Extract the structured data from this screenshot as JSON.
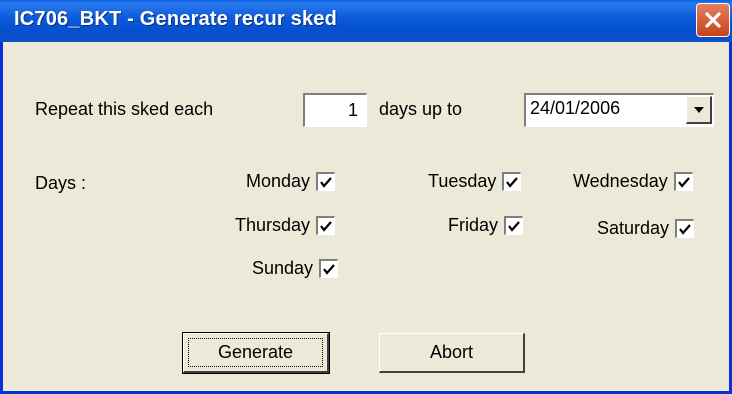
{
  "window": {
    "title": "IC706_BKT - Generate recur sked"
  },
  "repeat": {
    "label_prefix": "Repeat this sked each",
    "interval_value": "1",
    "label_suffix": "days up to",
    "end_date": "24/01/2006"
  },
  "days": {
    "label": "Days :",
    "items": [
      {
        "name": "Monday",
        "checked": true
      },
      {
        "name": "Tuesday",
        "checked": true
      },
      {
        "name": "Wednesday",
        "checked": true
      },
      {
        "name": "Thursday",
        "checked": true
      },
      {
        "name": "Friday",
        "checked": true
      },
      {
        "name": "Saturday",
        "checked": true
      },
      {
        "name": "Sunday",
        "checked": true
      }
    ]
  },
  "buttons": {
    "generate": "Generate",
    "abort": "Abort"
  }
}
